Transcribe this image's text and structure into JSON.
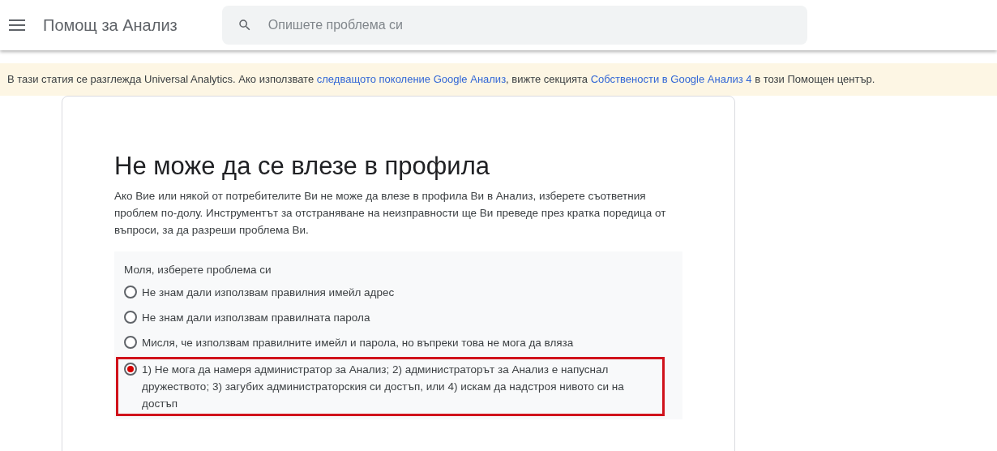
{
  "header": {
    "title": "Помощ за Анализ",
    "search": {
      "placeholder": "Опишете проблема си"
    }
  },
  "banner": {
    "parts": [
      {
        "text": "В тази статия се разглежда Universal Analytics. Ако използвате ",
        "link": false
      },
      {
        "text": "следващото поколение Google Анализ",
        "link": true
      },
      {
        "text": ", вижте секцията ",
        "link": false
      },
      {
        "text": "Собствености в Google Анализ 4",
        "link": true
      },
      {
        "text": " в този Помощен център.",
        "link": false
      }
    ]
  },
  "article": {
    "title": "Не може да се влезе в профила",
    "intro": "Ако Вие или някой от потребителите Ви не може да влезе в профила Ви в Анализ, изберете съответния проблем по-долу. Инструментът за отстраняване на неизправности ще Ви преведе през кратка поредица от въпроси, за да разреши проблема Ви.",
    "question": {
      "prompt": "Моля, изберете проблема си",
      "options": [
        {
          "label": "Не знам дали използвам правилния имейл адрес",
          "selected": false,
          "highlighted": false
        },
        {
          "label": "Не знам дали използвам правилната парола",
          "selected": false,
          "highlighted": false
        },
        {
          "label": "Мисля, че използвам правилните имейл и парола, но въпреки това не мога да вляза",
          "selected": false,
          "highlighted": false
        },
        {
          "label": "1) Не мога да намеря администратор за Анализ; 2) администраторът за Анализ е напуснал дружеството; 3) загубих администраторския си достъп, или 4) искам да надстроя нивото си на достъп",
          "selected": true,
          "highlighted": true
        }
      ]
    }
  }
}
